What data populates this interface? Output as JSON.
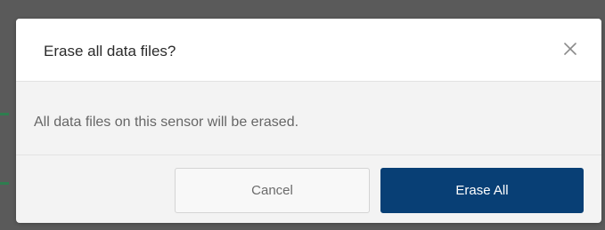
{
  "dialog": {
    "title": "Erase all data files?",
    "close_icon": "close-icon",
    "message": "All data files on this sensor will be erased.",
    "cancel_label": "Cancel",
    "confirm_label": "Erase All"
  },
  "colors": {
    "confirm_background": "#083f75",
    "backdrop": "#5a5a5a"
  }
}
